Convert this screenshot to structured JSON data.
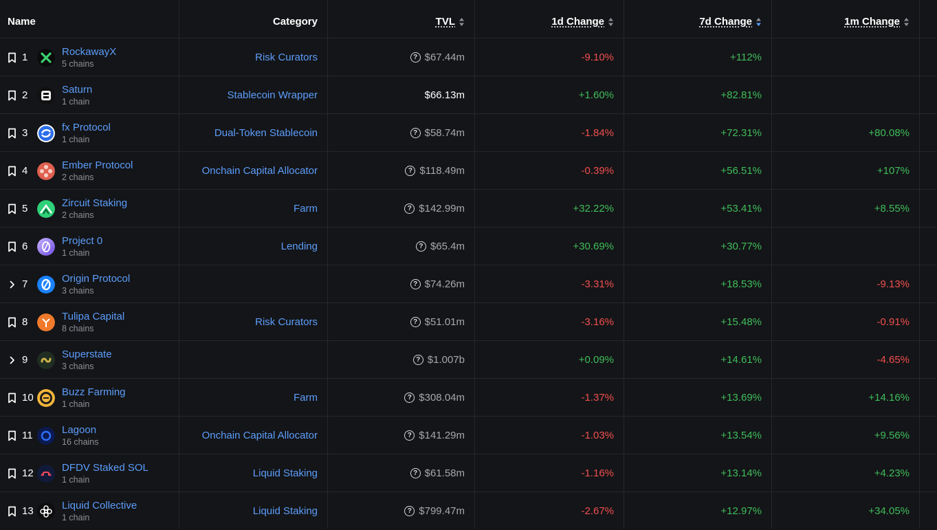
{
  "header": {
    "name": "Name",
    "category": "Category",
    "tvl": "TVL",
    "change_1d": "1d Change",
    "change_7d": "7d Change",
    "change_1m": "1m Change"
  },
  "colors": {
    "accent": "#5c9dfa",
    "positive": "#3fbd5b",
    "negative": "#f14f4f",
    "background": "#141518"
  },
  "rows": [
    {
      "rank": "1",
      "name": "RockawayX",
      "chains": "5 chains",
      "category": "Risk Curators",
      "tvl": "$67.44m",
      "d1": "-9.10%",
      "d7": "+112%",
      "m1": "",
      "icon": "bookmark-icon",
      "logo": "rockawayx-logo"
    },
    {
      "rank": "2",
      "name": "Saturn",
      "chains": "1 chain",
      "category": "Stablecoin Wrapper",
      "tvl": "$66.13m",
      "d1": "+1.60%",
      "d7": "+82.81%",
      "m1": "",
      "icon": "bookmark-icon",
      "logo": "saturn-logo"
    },
    {
      "rank": "3",
      "name": "fx Protocol",
      "chains": "1 chain",
      "category": "Dual-Token Stablecoin",
      "tvl": "$58.74m",
      "d1": "-1.84%",
      "d7": "+72.31%",
      "m1": "+80.08%",
      "icon": "bookmark-icon",
      "logo": "fx-protocol-logo"
    },
    {
      "rank": "4",
      "name": "Ember Protocol",
      "chains": "2 chains",
      "category": "Onchain Capital Allocator",
      "tvl": "$118.49m",
      "d1": "-0.39%",
      "d7": "+56.51%",
      "m1": "+107%",
      "icon": "bookmark-icon",
      "logo": "ember-protocol-logo"
    },
    {
      "rank": "5",
      "name": "Zircuit Staking",
      "chains": "2 chains",
      "category": "Farm",
      "tvl": "$142.99m",
      "d1": "+32.22%",
      "d7": "+53.41%",
      "m1": "+8.55%",
      "icon": "bookmark-icon",
      "logo": "zircuit-logo"
    },
    {
      "rank": "6",
      "name": "Project 0",
      "chains": "1 chain",
      "category": "Lending",
      "tvl": "$65.4m",
      "d1": "+30.69%",
      "d7": "+30.77%",
      "m1": "",
      "icon": "bookmark-icon",
      "logo": "project-0-logo"
    },
    {
      "rank": "7",
      "name": "Origin Protocol",
      "chains": "3 chains",
      "category": "",
      "tvl": "$74.26m",
      "d1": "-3.31%",
      "d7": "+18.53%",
      "m1": "-9.13%",
      "icon": "chevron-right-icon",
      "logo": "origin-protocol-logo"
    },
    {
      "rank": "8",
      "name": "Tulipa Capital",
      "chains": "8 chains",
      "category": "Risk Curators",
      "tvl": "$51.01m",
      "d1": "-3.16%",
      "d7": "+15.48%",
      "m1": "-0.91%",
      "icon": "bookmark-icon",
      "logo": "tulipa-logo"
    },
    {
      "rank": "9",
      "name": "Superstate",
      "chains": "3 chains",
      "category": "",
      "tvl": "$1.007b",
      "d1": "+0.09%",
      "d7": "+14.61%",
      "m1": "-4.65%",
      "icon": "chevron-right-icon",
      "logo": "superstate-logo"
    },
    {
      "rank": "10",
      "name": "Buzz Farming",
      "chains": "1 chain",
      "category": "Farm",
      "tvl": "$308.04m",
      "d1": "-1.37%",
      "d7": "+13.69%",
      "m1": "+14.16%",
      "icon": "bookmark-icon",
      "logo": "buzz-farming-logo"
    },
    {
      "rank": "11",
      "name": "Lagoon",
      "chains": "16 chains",
      "category": "Onchain Capital Allocator",
      "tvl": "$141.29m",
      "d1": "-1.03%",
      "d7": "+13.54%",
      "m1": "+9.56%",
      "icon": "bookmark-icon",
      "logo": "lagoon-logo"
    },
    {
      "rank": "12",
      "name": "DFDV Staked SOL",
      "chains": "1 chain",
      "category": "Liquid Staking",
      "tvl": "$61.58m",
      "d1": "-1.16%",
      "d7": "+13.14%",
      "m1": "+4.23%",
      "icon": "bookmark-icon",
      "logo": "dfdv-logo"
    },
    {
      "rank": "13",
      "name": "Liquid Collective",
      "chains": "1 chain",
      "category": "Liquid Staking",
      "tvl": "$799.47m",
      "d1": "-2.67%",
      "d7": "+12.97%",
      "m1": "+34.05%",
      "icon": "bookmark-icon",
      "logo": "liquid-collective-logo"
    }
  ]
}
